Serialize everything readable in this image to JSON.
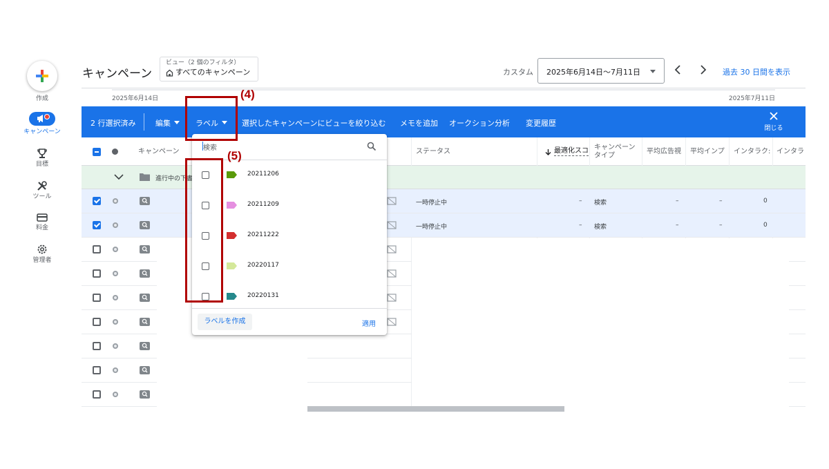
{
  "nav": {
    "create_label": "作成",
    "items": [
      {
        "label": "キャンペーン",
        "icon": "megaphone-icon"
      },
      {
        "label": "目標",
        "icon": "trophy-icon"
      },
      {
        "label": "ツール",
        "icon": "tools-icon"
      },
      {
        "label": "料金",
        "icon": "credit-card-icon"
      },
      {
        "label": "管理者",
        "icon": "gear-icon"
      }
    ]
  },
  "header": {
    "title": "キャンペーン",
    "view_subtitle": "ビュー（2 個のフィルタ）",
    "view_title": "すべてのキャンペーン",
    "custom_label": "カスタム",
    "date_range": "2025年6月14日〜7月11日",
    "past_30_link": "過去 30 日間を表示"
  },
  "timeline": {
    "start": "2025年6月14日",
    "end": "2025年7月11日"
  },
  "action_bar": {
    "selected_count": "2 行選択済み",
    "edit": "編集",
    "label": "ラベル",
    "narrow_view": "選択したキャンペーンにビューを絞り込む",
    "add_memo": "メモを追加",
    "auction": "オークション分析",
    "history": "変更履歴",
    "close": "閉じる"
  },
  "table": {
    "headers": {
      "campaign": "キャンペーン",
      "status": "ステータス",
      "opt_score": "最適化スコ",
      "campaign_type_1": "キャンペーン",
      "campaign_type_2": "タイプ",
      "avg_ad_view": "平均広告視",
      "avg_imp": "平均インプ",
      "interaction": "インタラク:",
      "interaction2": "インタラ"
    },
    "group_label": "進行中の下書",
    "rows": [
      {
        "selected": true,
        "status": "一時停止中",
        "opt": "–",
        "type": "検索",
        "avg1": "–",
        "avg2": "–",
        "inter": "0"
      },
      {
        "selected": true,
        "status": "一時停止中",
        "opt": "–",
        "type": "検索",
        "avg1": "–",
        "avg2": "–",
        "inter": "0"
      },
      {
        "selected": false
      },
      {
        "selected": false
      },
      {
        "selected": false
      },
      {
        "selected": false
      },
      {
        "selected": false
      },
      {
        "selected": false
      },
      {
        "selected": false
      }
    ]
  },
  "popup": {
    "search_placeholder": "検索",
    "labels": [
      {
        "name": "20211206",
        "color": "#5a9a0a"
      },
      {
        "name": "20211209",
        "color": "#e58fe0"
      },
      {
        "name": "20211222",
        "color": "#d32f2f"
      },
      {
        "name": "20220117",
        "color": "#d4e89a"
      },
      {
        "name": "20220131",
        "color": "#26898c"
      }
    ],
    "create_label": "ラベルを作成",
    "apply": "適用"
  },
  "callouts": {
    "c4": "(4)",
    "c5": "(5)"
  }
}
